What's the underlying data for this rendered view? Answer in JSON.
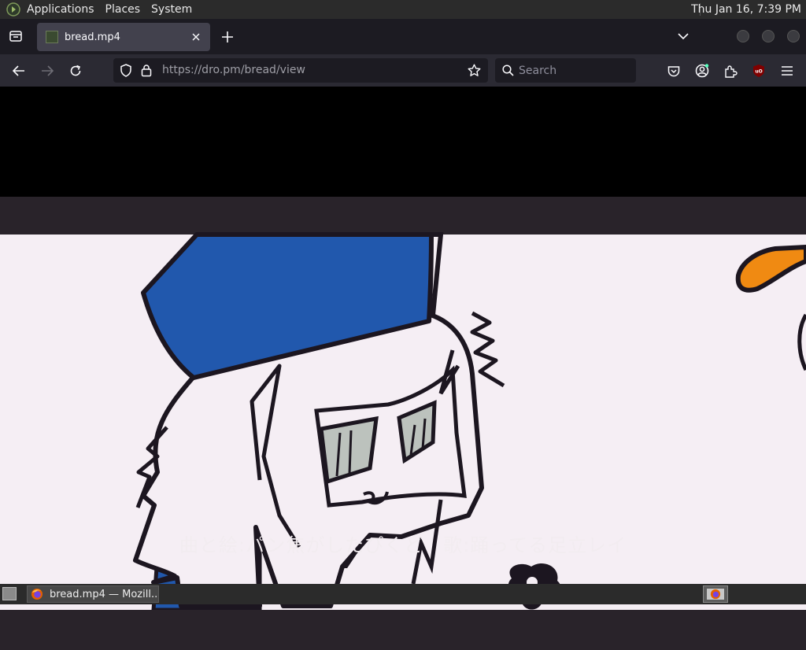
{
  "panel": {
    "menus": [
      "Applications",
      "Places",
      "System"
    ],
    "clock": "Thu Jan 16,  7:39 PM"
  },
  "tab": {
    "title": "bread.mp4"
  },
  "navbar": {
    "url_host": "https://dro.pm",
    "url_path": "/bread/view",
    "search_placeholder": "Search"
  },
  "video": {
    "subtitle": "曲と絵:パン焦がしたぴくど　歌:踊ってる足立レイ",
    "colors": {
      "hat_blue": "#2158ad",
      "background": "#f5eef4",
      "bar": "#29232a",
      "orange": "#f08a12"
    }
  },
  "taskbar": {
    "task_title": "bread.mp4 — Mozill..."
  },
  "colors": {
    "tab_strip": "#1c1b22",
    "nav_bar": "#2b2a33",
    "active_tab": "#42414d",
    "panel": "#2b2b2b"
  }
}
